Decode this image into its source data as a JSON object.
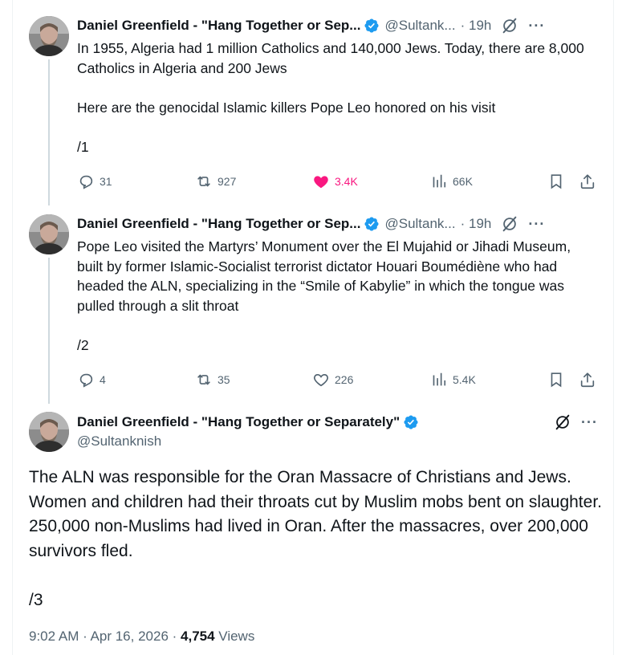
{
  "tweets": [
    {
      "author_name": "Daniel Greenfield - \"Hang Together or Sep...",
      "handle": "@Sultank...",
      "time": "· 19h",
      "text": "In 1955, Algeria had 1 million Catholics and 140,000 Jews. Today, there are 8,000 Catholics in Algeria and  200 Jews\n\nHere are the genocidal Islamic killers Pope Leo honored on his visit\n\n/1",
      "replies": "31",
      "reposts": "927",
      "likes": "3.4K",
      "liked": true,
      "views": "66K"
    },
    {
      "author_name": "Daniel Greenfield - \"Hang Together or Sep...",
      "handle": "@Sultank...",
      "time": "· 19h",
      "text": "Pope Leo visited the Martyrs’ Monument over the El Mujahid or Jihadi Museum, built by former Islamic-Socialist terrorist dictator Houari Boumédiène who had headed the ALN, specializing in the “Smile of Kabylie” in which the tongue was pulled through a slit throat\n\n/2",
      "replies": "4",
      "reposts": "35",
      "likes": "226",
      "liked": false,
      "views": "5.4K"
    }
  ],
  "main_tweet": {
    "author_name": "Daniel Greenfield - \"Hang Together or Separately\"",
    "handle": "@Sultanknish",
    "text": "The ALN was responsible for the Oran Massacre of Christians and Jews. Women and children had their throats cut by Muslim mobs bent on slaughter. 250,000 non-Muslims had lived in Oran. After the massacres, over 200,000 survivors fled.\n\n/3",
    "timestamp": "9:02 AM · Apr 16, 2026 · ",
    "views_count": "4,754",
    "views_label": " Views"
  },
  "icons": {
    "verified": "verified-badge-icon",
    "grok": "grok-icon",
    "more": "more-icon",
    "reply": "reply-icon",
    "repost": "repost-icon",
    "like": "heart-icon",
    "views": "analytics-icon",
    "bookmark": "bookmark-icon",
    "share": "share-icon"
  },
  "colors": {
    "verified": "#1d9bf0",
    "like": "#f91880",
    "secondary_text": "#536471",
    "thread_line": "#cfd9de"
  }
}
